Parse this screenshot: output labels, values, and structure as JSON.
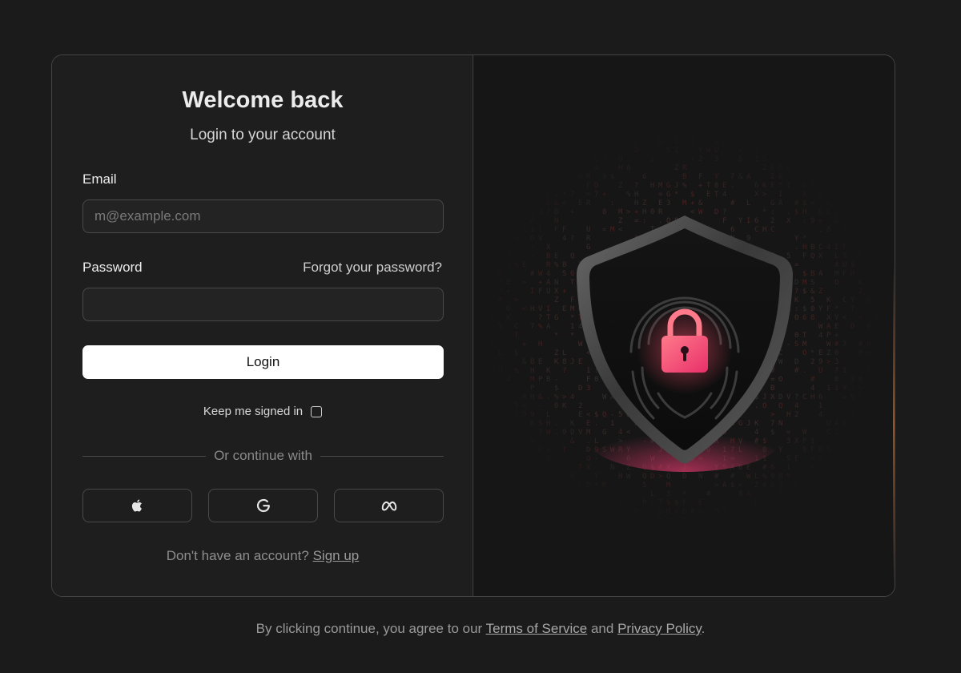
{
  "login": {
    "title": "Welcome back",
    "subtitle": "Login to your account",
    "email_label": "Email",
    "email_placeholder": "m@example.com",
    "email_value": "",
    "password_label": "Password",
    "password_value": "",
    "forgot_label": "Forgot your password?",
    "login_label": "Login",
    "keep_signed_in_label": "Keep me signed in",
    "keep_signed_in_checked": false,
    "divider_text": "Or continue with",
    "social_buttons": [
      {
        "icon": "apple-icon"
      },
      {
        "icon": "google-icon"
      },
      {
        "icon": "meta-icon"
      }
    ],
    "no_account_text": "Don't have an account?",
    "signup_label": "Sign up"
  },
  "illustration": {
    "icon": "shield-lock-fingerprint-icon",
    "accent_color": "#ff4f6d"
  },
  "footer": {
    "prefix": "By clicking continue, you agree to our",
    "terms_label": "Terms of Service",
    "conjunction": "and",
    "privacy_label": "Privacy Policy",
    "suffix": "."
  }
}
